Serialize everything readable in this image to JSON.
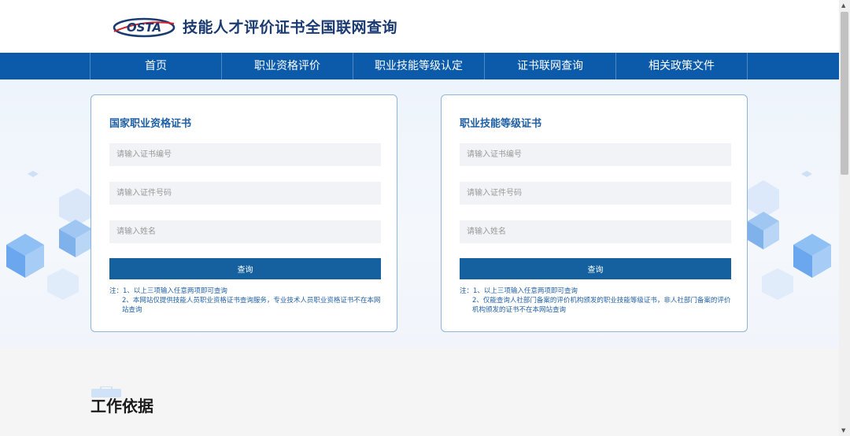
{
  "header": {
    "logo_text": "OSTA",
    "title": "技能人才评价证书全国联网查询"
  },
  "nav": {
    "items": [
      {
        "label": "首页"
      },
      {
        "label": "职业资格评价"
      },
      {
        "label": "职业技能等级认定"
      },
      {
        "label": "证书联网查询"
      },
      {
        "label": "相关政策文件"
      }
    ]
  },
  "cards": [
    {
      "title": "国家职业资格证书",
      "cert_placeholder": "请输入证书编号",
      "id_placeholder": "请输入证件号码",
      "name_placeholder": "请输入姓名",
      "button_label": "查询",
      "note_line1": "注：1、以上三项输入任意两项即可查询",
      "note_line2": "2、本网站仅提供技能人员职业资格证书查询服务，专业技术人员职业资格证书不在本网站查询"
    },
    {
      "title": "职业技能等级证书",
      "cert_placeholder": "请输入证书编号",
      "id_placeholder": "请输入证件号码",
      "name_placeholder": "请输入姓名",
      "button_label": "查询",
      "note_line1": "注：1、以上三项输入任意两项即可查询",
      "note_line2": "2、仅能查询人社部门备案的评价机构颁发的职业技能等级证书，非人社部门备案的评价机构颁发的证书不在本网站查询"
    }
  ],
  "section": {
    "title": "工作依据"
  },
  "colors": {
    "nav_bg": "#0b5baa",
    "button_bg": "#15609f",
    "title_blue": "#1f5fa3",
    "logo_navy": "#1a3a72"
  },
  "icons": {
    "logo": "osta-logo-icon",
    "scroll_up": "scroll-up-arrow-icon",
    "scroll_down": "scroll-down-arrow-icon"
  }
}
